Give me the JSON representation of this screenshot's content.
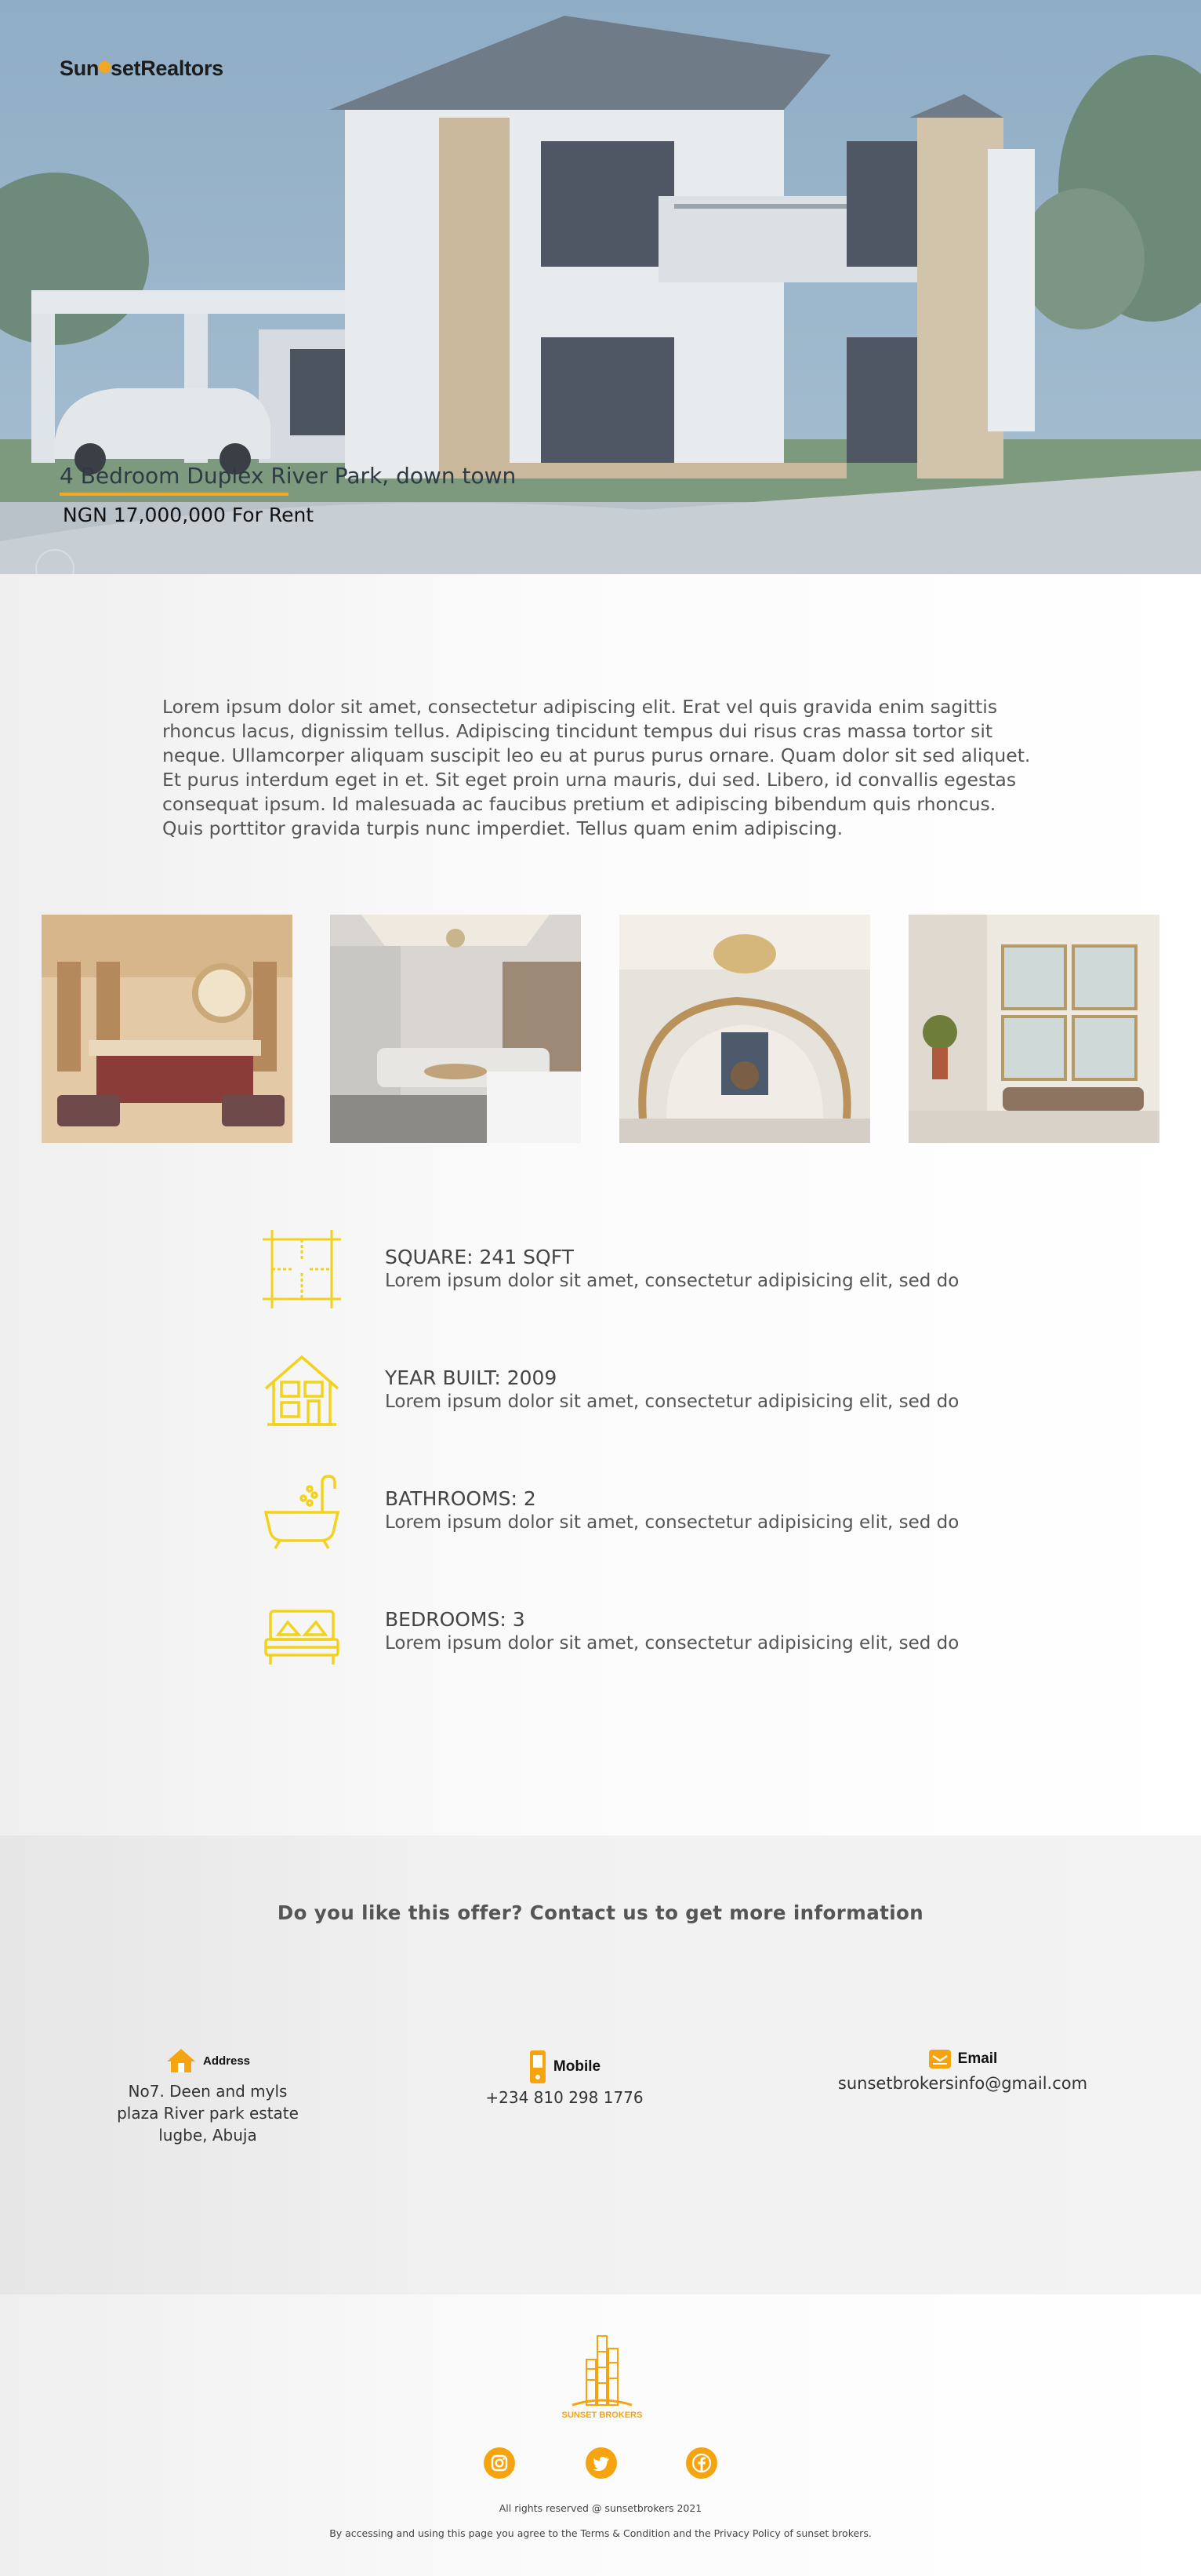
{
  "brand": {
    "name_prefix": "Sun",
    "name_suffix": "setRealtors"
  },
  "hero": {
    "title": "4 Bedroom Duplex River Park, down town",
    "price": "NGN 17,000,000 For Rent"
  },
  "description": "Lorem ipsum dolor sit amet, consectetur adipiscing elit. Erat vel quis gravida enim sagittis rhoncus lacus, dignissim tellus. Adipiscing tincidunt tempus dui risus cras massa tortor sit neque. Ullamcorper aliquam suscipit leo eu at purus purus ornare. Quam dolor sit sed aliquet. Et purus interdum eget in et. Sit eget proin urna mauris, dui sed. Libero, id convallis egestas consequat ipsum. Id malesuada ac faucibus pretium et adipiscing bibendum quis rhoncus. Quis porttitor gravida turpis nunc imperdiet. Tellus quam enim adipiscing.",
  "gallery": [
    "bedroom-photo",
    "living-room-photo",
    "staircase-photo",
    "hallway-photo"
  ],
  "features": [
    {
      "icon": "floor-plan-icon",
      "title": "SQUARE: 241 SQFT",
      "text": "Lorem ipsum dolor sit amet, consectetur adipisicing elit, sed do"
    },
    {
      "icon": "house-icon",
      "title": "YEAR BUILT: 2009",
      "text": "Lorem ipsum dolor sit amet, consectetur adipisicing elit, sed do"
    },
    {
      "icon": "bathtub-icon",
      "title": "BATHROOMS: 2",
      "text": "Lorem ipsum dolor sit amet, consectetur adipisicing elit, sed do"
    },
    {
      "icon": "bed-icon",
      "title": "BEDROOMS: 3",
      "text": "Lorem ipsum dolor sit amet, consectetur adipisicing elit, sed do"
    }
  ],
  "contact": {
    "heading": "Do you like this offer? Contact us to get more information",
    "address": {
      "label": "Address",
      "value": "No7. Deen and myls plaza River park estate lugbe, Abuja"
    },
    "mobile": {
      "label": "Mobile",
      "value": "+234 810 298 1776"
    },
    "email": {
      "label": "Email",
      "value": "sunsetbrokersinfo@gmail.com"
    }
  },
  "footer": {
    "logo_text": "SUNSET BROKERS",
    "social": [
      "instagram-icon",
      "twitter-icon",
      "facebook-icon"
    ],
    "rights": "All rights reserved @  sunsetbrokers 2021",
    "terms": "By accessing and using this page you agree to the Terms & Condition and the Privacy Policy of sunset brokers."
  },
  "colors": {
    "accent": "#f5a30f",
    "icon_yellow": "#f2d21c",
    "hero_sky": "#94b0c8"
  }
}
